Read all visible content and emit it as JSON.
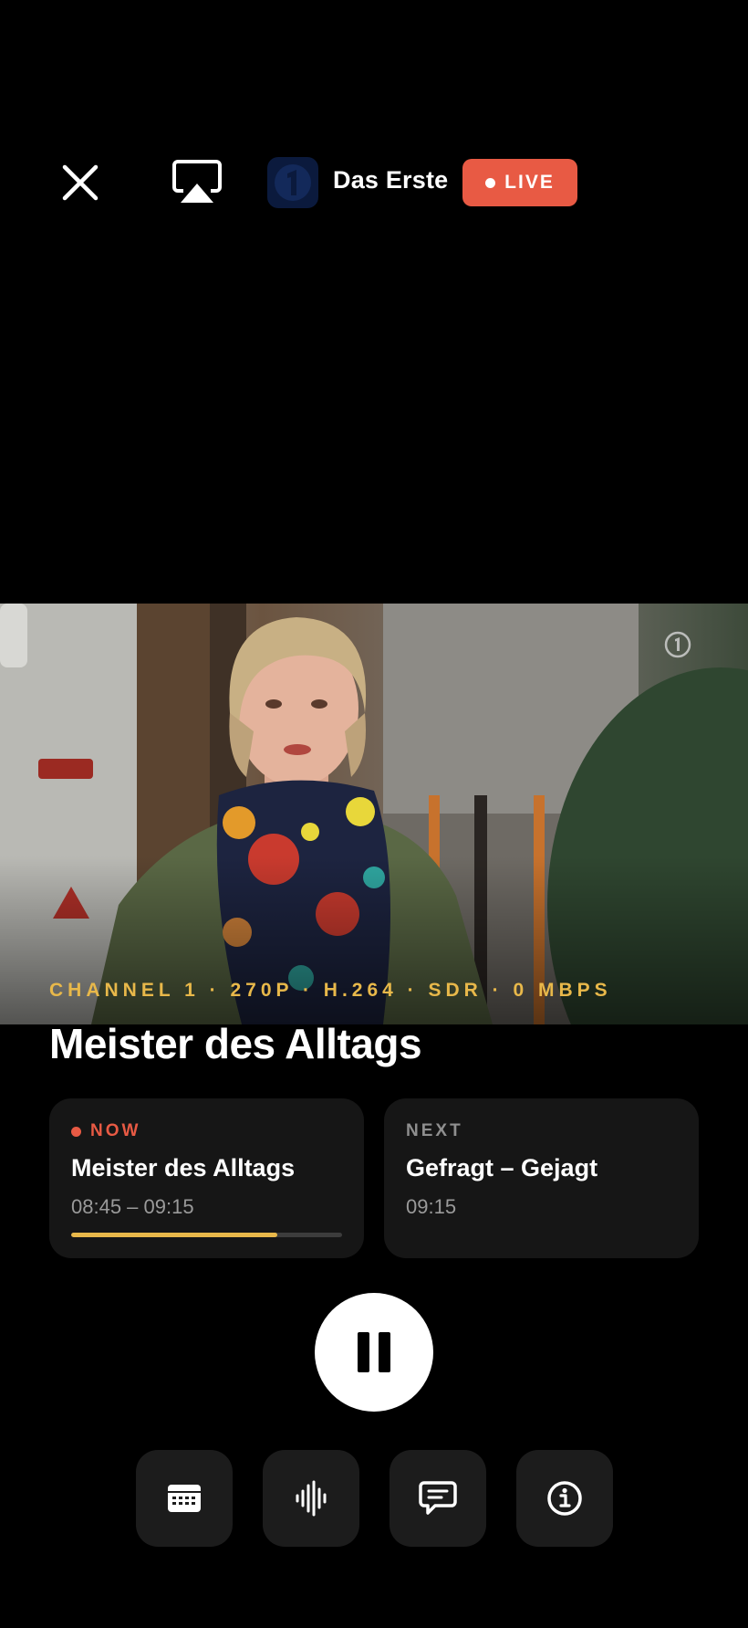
{
  "header": {
    "close_icon": "close-icon",
    "airplay_icon": "airplay-icon",
    "channel_name": "Das Erste",
    "live_label": "LIVE",
    "live_color": "#e85a44"
  },
  "player": {
    "stream_info": "CHANNEL 1 · 270P · H.264 · SDR · 0 MBPS",
    "program_title": "Meister des Alltags"
  },
  "epg": {
    "now": {
      "label": "NOW",
      "title": "Meister des Alltags",
      "time": "08:45 – 09:15",
      "progress": 0.76
    },
    "next": {
      "label": "NEXT",
      "title": "Gefragt – Gejagt",
      "time": "09:15"
    }
  },
  "controls": {
    "pause_icon": "pause-icon",
    "tools": [
      "epg-guide-icon",
      "audio-track-icon",
      "subtitles-icon",
      "info-icon"
    ]
  },
  "colors": {
    "accent": "#e8b84a",
    "live": "#e85a44",
    "card_bg": "#161616"
  }
}
